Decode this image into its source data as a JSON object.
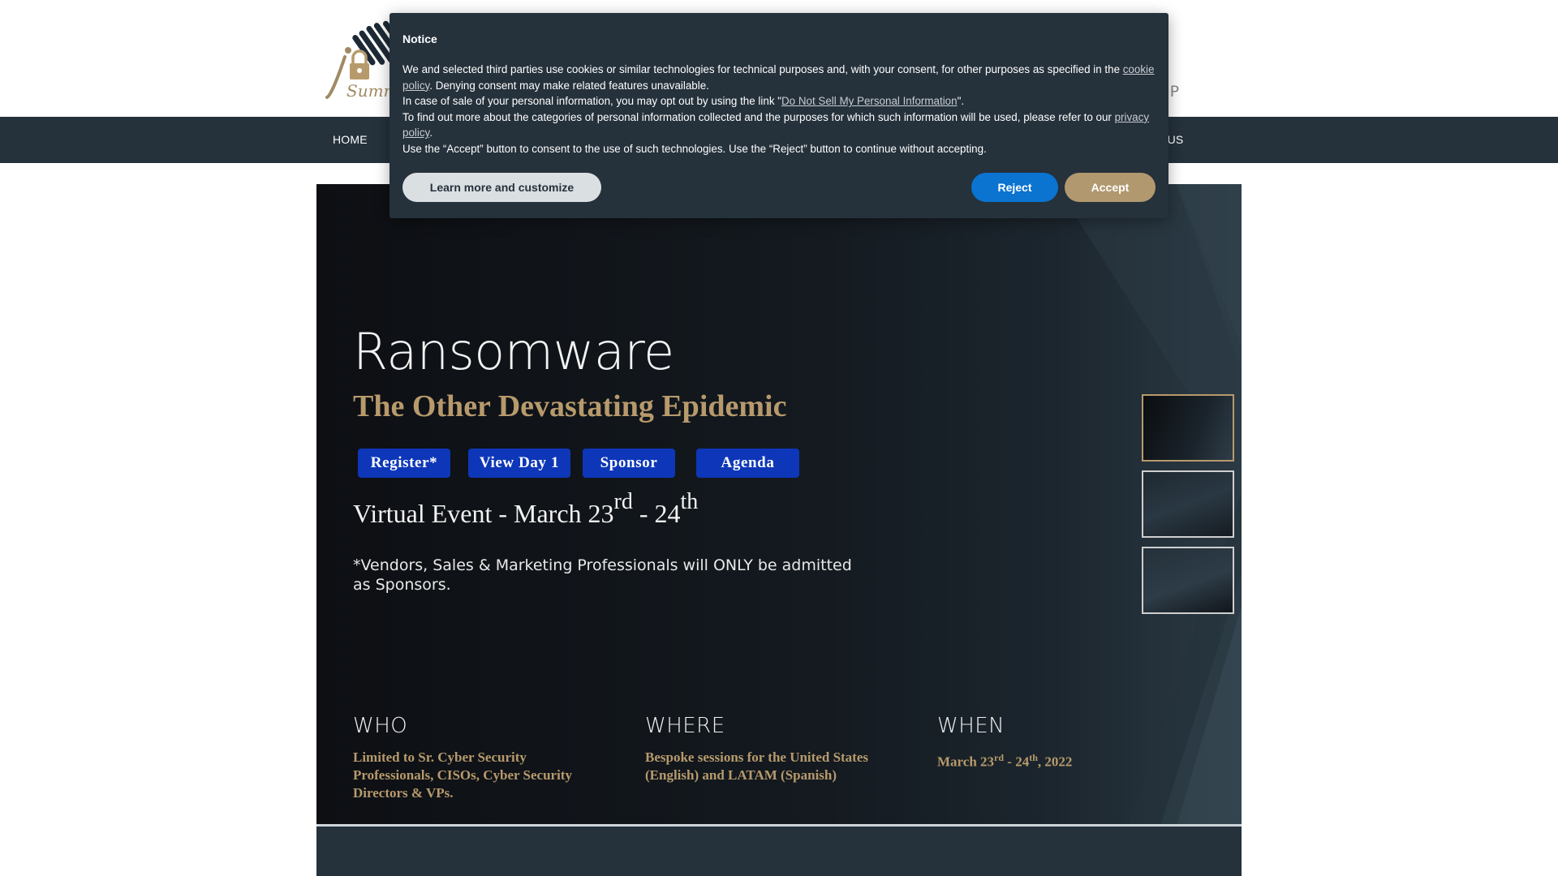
{
  "header": {
    "logo_text": "Summit",
    "right_fragment": "IP",
    "logo_icon": "lock-waves-logo"
  },
  "nav": {
    "home": "HOME",
    "contact": "T US"
  },
  "hero": {
    "title": "Ransomware",
    "subtitle": "The Other Devastating Epidemic",
    "buttons": {
      "register": "Register*",
      "view_day1": "View Day 1",
      "sponsor": "Sponsor",
      "agenda": "Agenda"
    },
    "event": {
      "prefix": "Virtual Event - March 23",
      "sup1": "rd",
      "mid": " - 24",
      "sup2": "th"
    },
    "note": "*Vendors, Sales & Marketing Professionals will ONLY be admitted as Sponsors.",
    "who": {
      "heading": "WHO",
      "text": "Limited to Sr. Cyber Security Professionals, CISOs, Cyber Security Directors & VPs."
    },
    "where": {
      "heading": "WHERE",
      "text": "Bespoke sessions for the United States (English) and LATAM (Spanish)"
    },
    "when": {
      "heading": "WHEN",
      "prefix": "March 23",
      "sup1": "rd",
      "mid": " - 24",
      "sup2": "th",
      "suffix": ", 2022"
    }
  },
  "notice": {
    "title": "Notice",
    "p1_a": "We and selected third parties use cookies or similar technologies for technical purposes and, with your consent, for other purposes as specified in the ",
    "p1_link": "cookie policy",
    "p1_b": ". Denying consent may make related features unavailable.",
    "p2_a": "In case of sale of your personal information, you may opt out by using the link \"",
    "p2_link": "Do Not Sell My Personal Information",
    "p2_b": "\".",
    "p3_a": "To find out more about the categories of personal information collected and the purposes for which such information will be used, please refer to our ",
    "p3_link": "privacy policy",
    "p3_b": ".",
    "p4": "Use the “Accept” button to consent to the use of such technologies. Use the “Reject” button to continue without accepting.",
    "learn_label": "Learn more and customize",
    "reject_label": "Reject",
    "accept_label": "Accept"
  },
  "colors": {
    "nav_bg": "#25313b",
    "accent_gold": "#b79a6c",
    "button_blue": "#0d37b8",
    "reject_blue": "#0b73d0",
    "accept_gold": "#b2986e"
  }
}
